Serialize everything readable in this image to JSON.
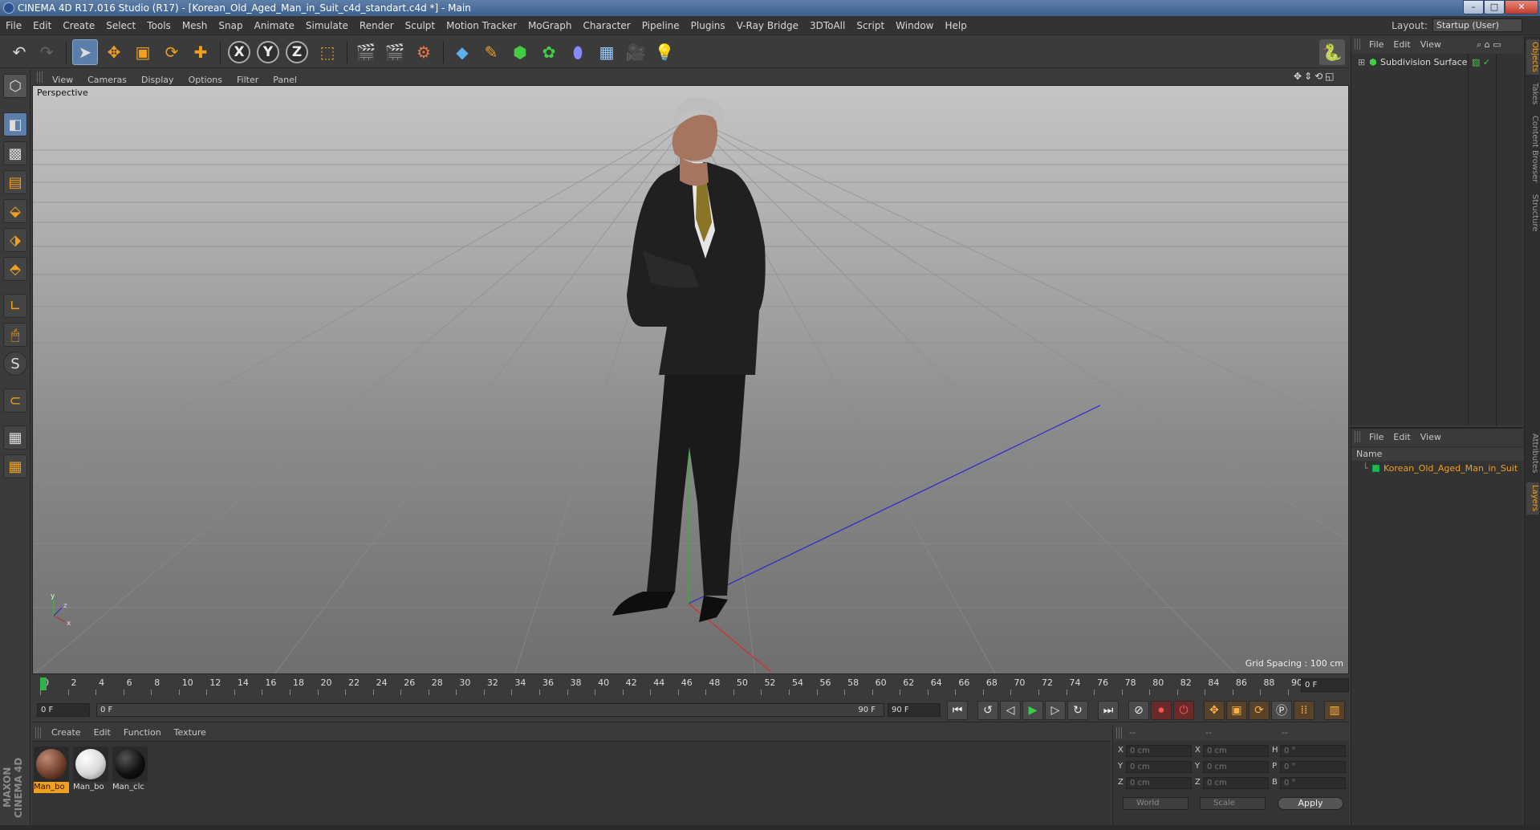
{
  "window": {
    "title": "CINEMA 4D R17.016 Studio (R17) - [Korean_Old_Aged_Man_in_Suit_c4d_standart.c4d *] - Main",
    "minimize": "–",
    "maximize": "□",
    "close": "✕"
  },
  "menubar": {
    "items": [
      "File",
      "Edit",
      "Create",
      "Select",
      "Tools",
      "Mesh",
      "Snap",
      "Animate",
      "Simulate",
      "Render",
      "Sculpt",
      "Motion Tracker",
      "MoGraph",
      "Character",
      "Pipeline",
      "Plugins",
      "V-Ray Bridge",
      "3DToAll",
      "Script",
      "Window",
      "Help"
    ],
    "layout_label": "Layout:",
    "layout_value": "Startup (User)"
  },
  "toolbar": {
    "undo_icon": "undo-icon",
    "redo_icon": "redo-icon",
    "axis_x": "X",
    "axis_y": "Y",
    "axis_z": "Z"
  },
  "viewport": {
    "menu": [
      "View",
      "Cameras",
      "Display",
      "Options",
      "Filter",
      "Panel"
    ],
    "label": "Perspective",
    "grid_spacing": "Grid Spacing : 100 cm",
    "axis_labels": {
      "y": "y",
      "x": "x",
      "z": "z"
    }
  },
  "timeline": {
    "ticks": [
      "0",
      "2",
      "4",
      "6",
      "8",
      "10",
      "12",
      "14",
      "16",
      "18",
      "20",
      "22",
      "24",
      "26",
      "28",
      "30",
      "32",
      "34",
      "36",
      "38",
      "40",
      "42",
      "44",
      "46",
      "48",
      "50",
      "52",
      "54",
      "56",
      "58",
      "60",
      "62",
      "64",
      "66",
      "68",
      "70",
      "72",
      "74",
      "76",
      "78",
      "80",
      "82",
      "84",
      "86",
      "88",
      "90"
    ],
    "current_frame": "0 F",
    "start_field": "0 F",
    "range_start": "0 F",
    "range_end": "90 F",
    "end_field": "90 F"
  },
  "materials": {
    "menu": [
      "Create",
      "Edit",
      "Function",
      "Texture"
    ],
    "items": [
      {
        "label": "Man_bo",
        "color": "#6b3b2a"
      },
      {
        "label": "Man_bo",
        "color": "#d8d8d8"
      },
      {
        "label": "Man_clc",
        "color": "#111111"
      }
    ],
    "brand": "MAXON CINEMA 4D"
  },
  "coordinates": {
    "header": [
      "--",
      "--",
      "--"
    ],
    "rows": [
      {
        "a": "X",
        "av": "0 cm",
        "b": "X",
        "bv": "0 cm",
        "c": "H",
        "cv": "0 °"
      },
      {
        "a": "Y",
        "av": "0 cm",
        "b": "Y",
        "bv": "0 cm",
        "c": "P",
        "cv": "0 °"
      },
      {
        "a": "Z",
        "av": "0 cm",
        "b": "Z",
        "bv": "0 cm",
        "c": "B",
        "cv": "0 °"
      }
    ],
    "mode": "World",
    "transform": "Scale",
    "apply": "Apply"
  },
  "objects": {
    "menu": [
      "File",
      "Edit",
      "View"
    ],
    "rows": [
      "Subdivision Surface"
    ]
  },
  "layers": {
    "menu": [
      "File",
      "Edit",
      "View"
    ],
    "name_header": "Name",
    "rows": [
      "Korean_Old_Aged_Man_in_Suit"
    ]
  },
  "right_tabs": [
    "Objects",
    "Takes",
    "Content Browser",
    "Structure",
    "Attributes",
    "Layers"
  ]
}
